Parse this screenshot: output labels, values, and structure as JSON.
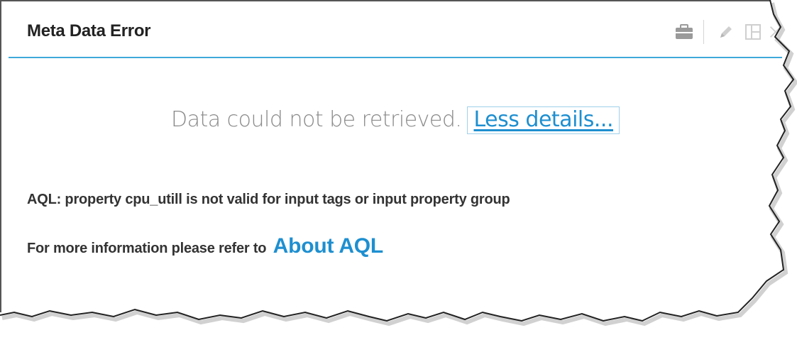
{
  "window": {
    "title": "Meta Data Error"
  },
  "toolbar": {
    "icons": [
      "briefcase-icon",
      "pencil-icon",
      "layout-icon",
      "close-icon"
    ]
  },
  "error": {
    "message": "Data could not be retrieved.",
    "toggle_label": "Less details...",
    "detail": "AQL: property cpu_utill is not valid for input tags or input property group",
    "more_info_text": "For more information please refer to",
    "more_info_link": "About AQL"
  },
  "colors": {
    "accent": "#3fa9d9",
    "link": "#1e8fd0",
    "muted_text": "#8a8a8a",
    "icon": "#c8c8c8"
  }
}
